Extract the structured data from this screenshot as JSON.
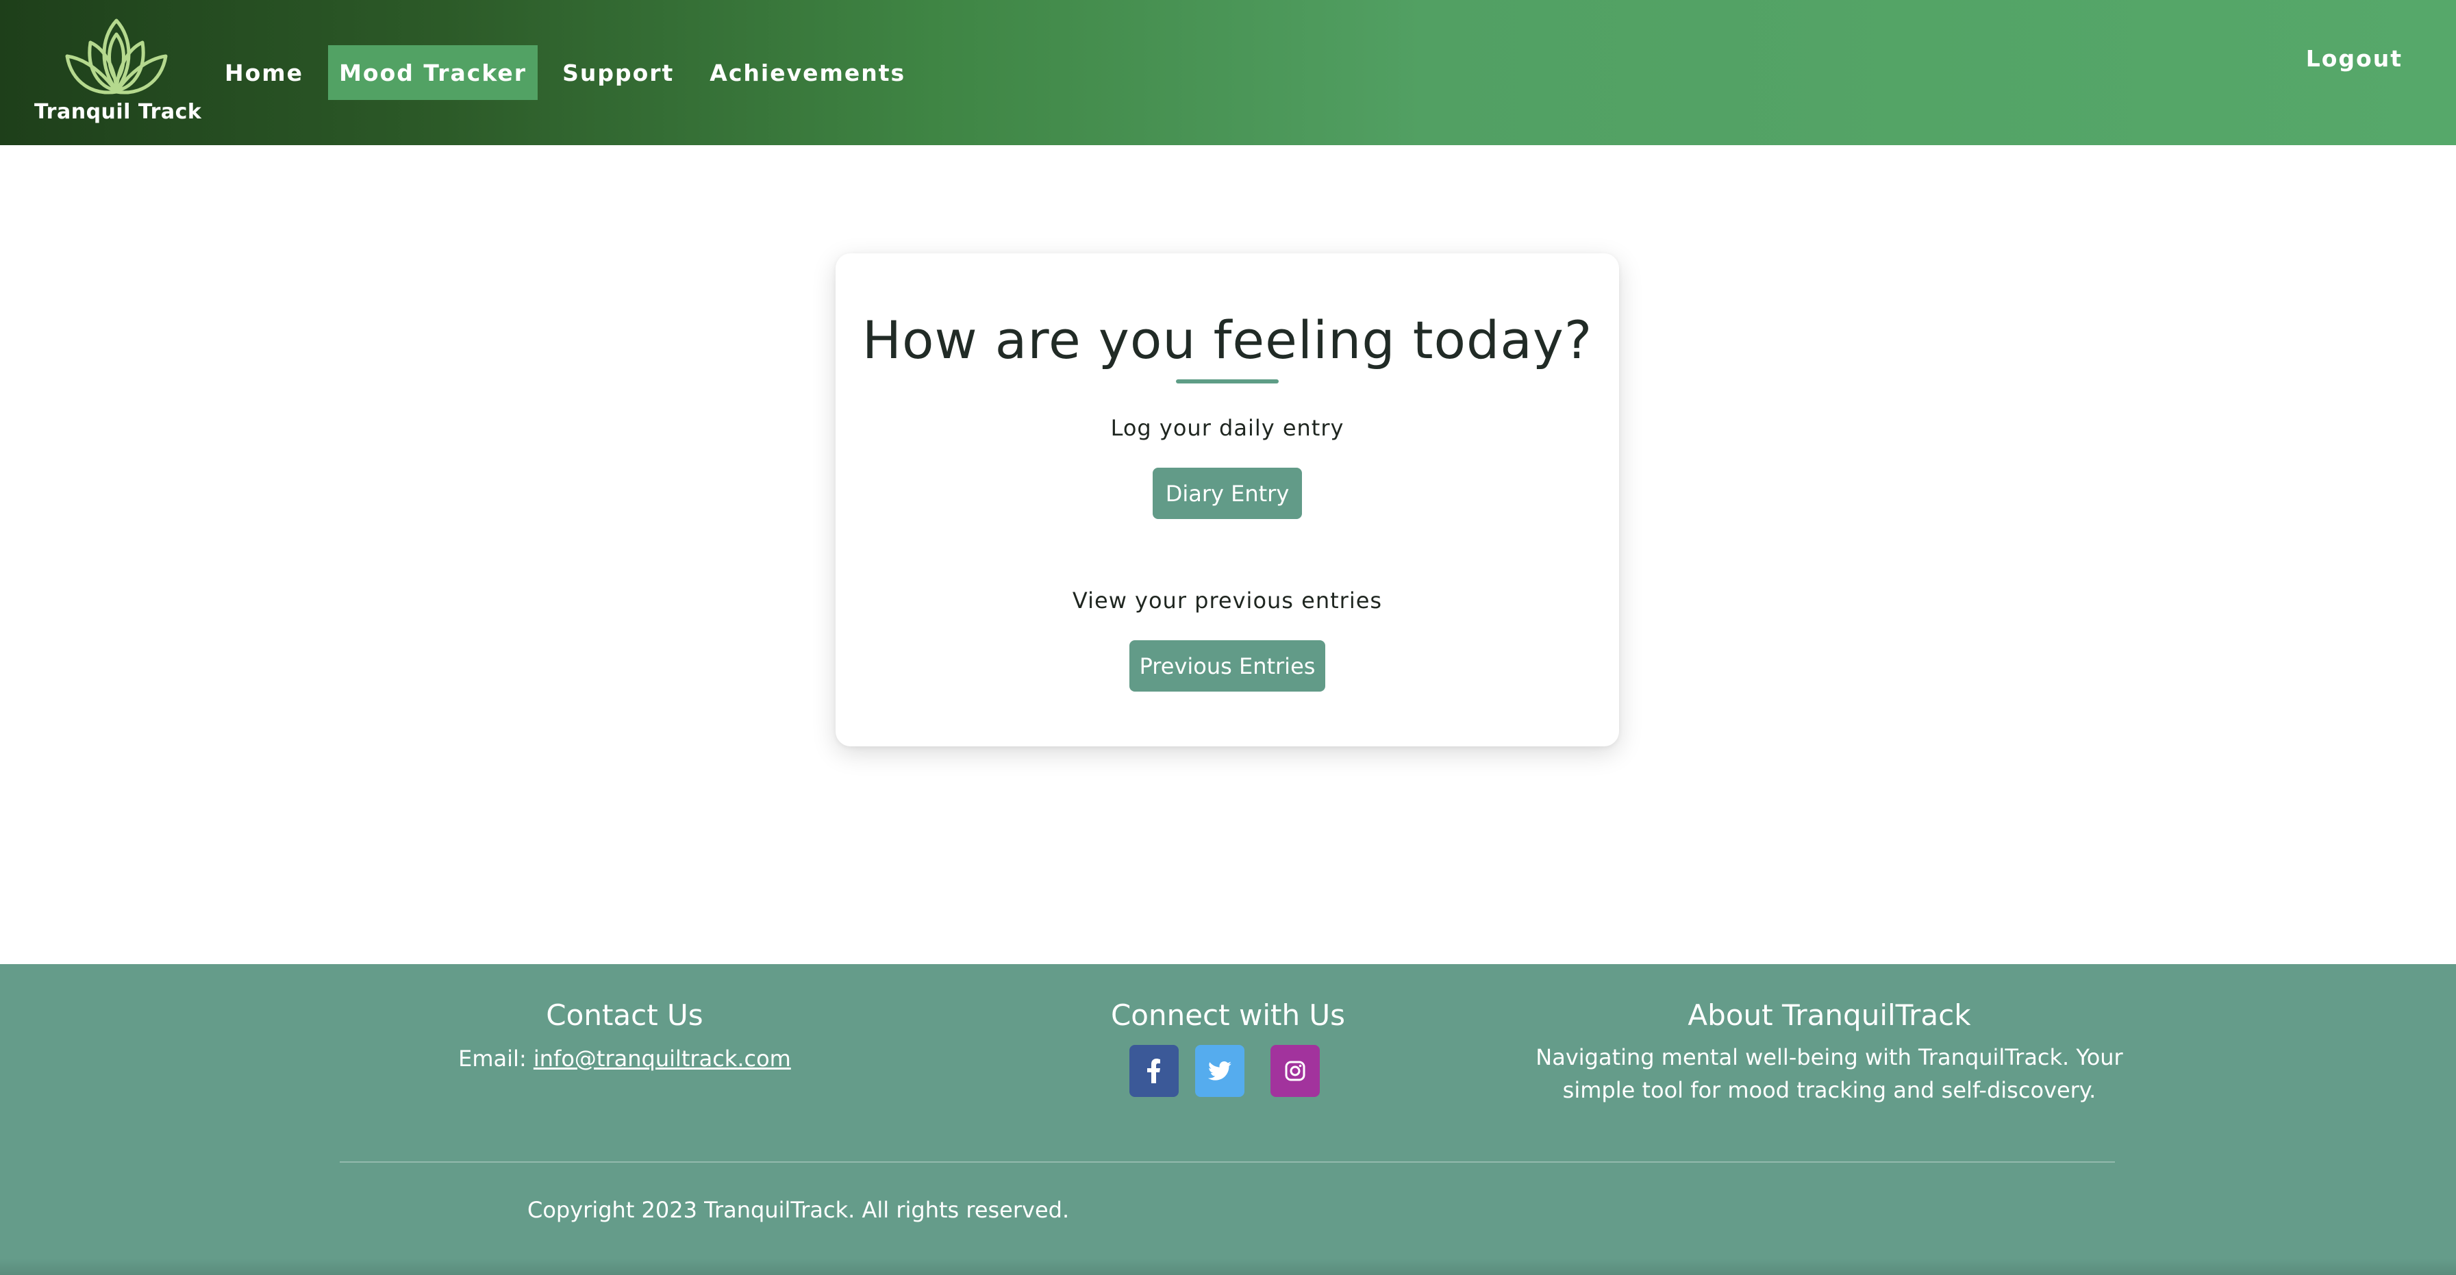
{
  "app": {
    "name": "Tranquil Track"
  },
  "header": {
    "nav": [
      {
        "label": "Home"
      },
      {
        "label": "Mood Tracker",
        "active": true
      },
      {
        "label": "Support"
      },
      {
        "label": "Achievements"
      }
    ],
    "logout_label": "Logout",
    "logo_icon": "lotus-icon"
  },
  "main": {
    "title": "How are you feeling today?",
    "diary": {
      "label": "Log your daily entry",
      "button": "Diary Entry"
    },
    "previous": {
      "label": "View your previous entries",
      "button": "Previous Entries"
    }
  },
  "footer": {
    "contact": {
      "title": "Contact Us",
      "email_prefix": "Email: ",
      "email": "info@tranquiltrack.com"
    },
    "connect": {
      "title": "Connect with Us",
      "socials": [
        {
          "icon": "facebook-icon",
          "color": "#3b5998"
        },
        {
          "icon": "twitter-icon",
          "color": "#55acee"
        },
        {
          "icon": "instagram-icon",
          "color": "#a2339d"
        }
      ]
    },
    "about": {
      "title": "About TranquilTrack",
      "line1": "Navigating mental well-being with TranquilTrack. Your",
      "line2": "simple tool for mood tracking and self-discovery."
    },
    "copyright": "Copyright 2023 TranquilTrack. All rights reserved."
  },
  "colors": {
    "accent": "#629b88",
    "nav_active": "#52a264",
    "footer_bg": "#659c8a",
    "header_dark": "#1e3f1a",
    "header_light": "#56a86a"
  }
}
